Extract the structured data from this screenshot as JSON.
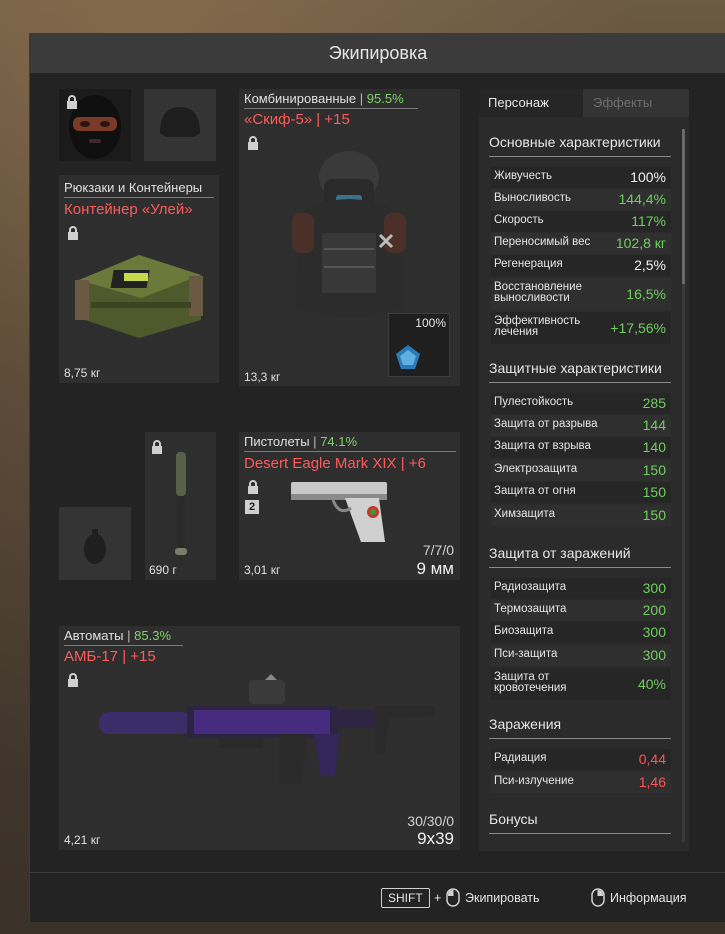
{
  "window": {
    "title": "Экипировка"
  },
  "container": {
    "category": "Рюкзаки и Контейнеры",
    "name": "Контейнер «Улей»",
    "weight": "8,75 кг"
  },
  "armor": {
    "category": "Комбинированные",
    "condition": "95.5%",
    "name": "«Скиф-5» | +15",
    "plate_condition": "100%",
    "weight": "13,3 кг"
  },
  "melee": {
    "weight": "690 г"
  },
  "pistol": {
    "category": "Пистолеты",
    "condition": "74.1%",
    "name": "Desert Eagle Mark XIX | +6",
    "slot_number": "2",
    "ammo": "7/7/0",
    "caliber": "9 мм",
    "weight": "3,01 кг"
  },
  "rifle": {
    "category": "Автоматы",
    "condition": "85.3%",
    "name": "АМБ-17 | +15",
    "ammo": "30/30/0",
    "caliber": "9х39",
    "weight": "4,21 кг"
  },
  "stats": {
    "tabs": [
      "Персонаж",
      "Эффекты"
    ],
    "sections": [
      {
        "title": "Основные характеристики",
        "rows": [
          {
            "label": "Живучесть",
            "value": "100%"
          },
          {
            "label": "Выносливость",
            "value": "144,4%"
          },
          {
            "label": "Скорость",
            "value": "117%"
          },
          {
            "label": "Переносимый вес",
            "value": "102,8 кг"
          },
          {
            "label": "Регенерация",
            "value": "2,5%"
          },
          {
            "label": "Восстановление выносливости",
            "value": "16,5%"
          },
          {
            "label": "Эффективность лечения",
            "value": "+17,56%"
          }
        ]
      },
      {
        "title": "Защитные характеристики",
        "rows": [
          {
            "label": "Пулестойкость",
            "value": "285"
          },
          {
            "label": "Защита от разрыва",
            "value": "144"
          },
          {
            "label": "Защита от взрыва",
            "value": "140"
          },
          {
            "label": "Электрозащита",
            "value": "150"
          },
          {
            "label": "Защита от огня",
            "value": "150"
          },
          {
            "label": "Химзащита",
            "value": "150"
          }
        ]
      },
      {
        "title": "Защита от заражений",
        "rows": [
          {
            "label": "Радиозащита",
            "value": "300"
          },
          {
            "label": "Термозащита",
            "value": "200"
          },
          {
            "label": "Биозащита",
            "value": "300"
          },
          {
            "label": "Пси-защита",
            "value": "300"
          },
          {
            "label": "Защита от кровотечения",
            "value": "40%"
          }
        ]
      },
      {
        "title": "Заражения",
        "rows": [
          {
            "label": "Радиация",
            "value": "0,44"
          },
          {
            "label": "Пси-излучение",
            "value": "1,46"
          }
        ]
      },
      {
        "title": "Бонусы",
        "rows": []
      }
    ]
  },
  "footer": {
    "shift_key": "SHIFT",
    "plus": "+",
    "equip": "Экипировать",
    "info": "Информация"
  },
  "colors": {
    "item_name": "#ff5a5a",
    "condition": "#7fd46a",
    "stat_positive": "#6fcf5e",
    "stat_negative": "#ff5555"
  }
}
